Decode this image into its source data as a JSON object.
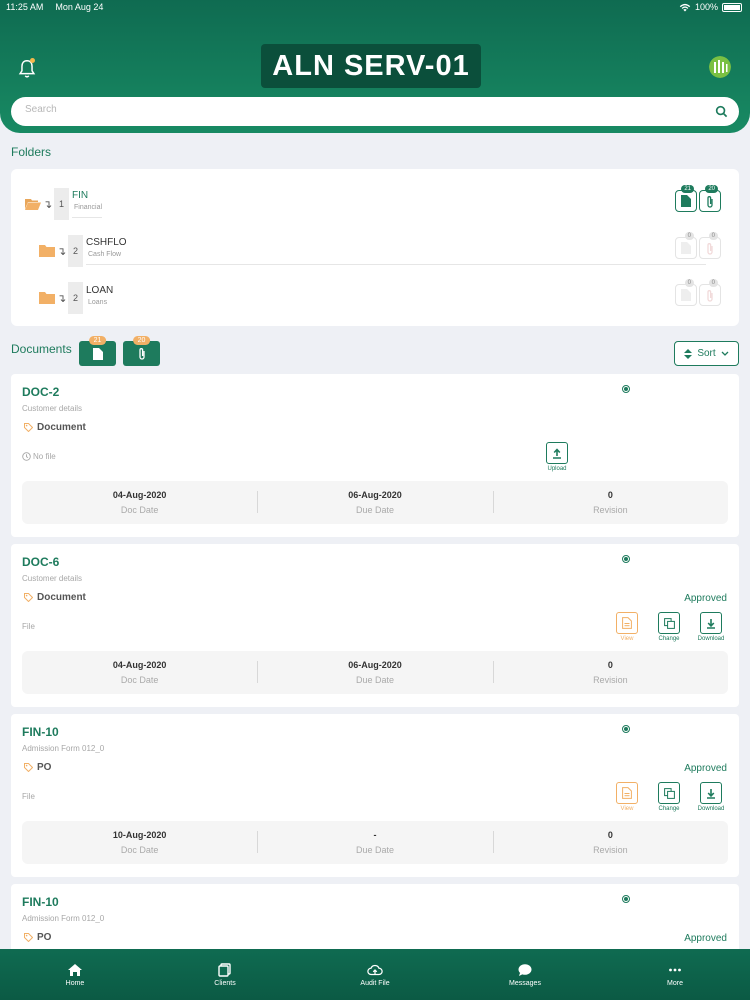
{
  "status_bar": {
    "time": "11:25 AM",
    "date": "Mon Aug 24",
    "battery": "100%"
  },
  "header": {
    "title": "ALN SERV-01"
  },
  "search": {
    "placeholder": "Search"
  },
  "folders": {
    "label": "Folders",
    "items": [
      {
        "level": "1",
        "name": "FIN",
        "sub": "Financial",
        "doc_count": "21",
        "attach_count": "20",
        "active": true
      },
      {
        "level": "2",
        "name": "CSHFLO",
        "sub": "Cash Flow",
        "doc_count": "0",
        "attach_count": "0",
        "active": false
      },
      {
        "level": "2",
        "name": "LOAN",
        "sub": "Loans",
        "doc_count": "0",
        "attach_count": "0",
        "active": false
      }
    ]
  },
  "documents": {
    "label": "Documents",
    "doc_count": "21",
    "attach_count": "20",
    "sort_label": "Sort"
  },
  "labels": {
    "doc_date": "Doc Date",
    "due_date": "Due Date",
    "revision": "Revision",
    "view": "View",
    "change": "Change",
    "download": "Download",
    "upload": "Upload"
  },
  "cards": [
    {
      "code": "DOC-2",
      "desc": "Customer details",
      "tag": "Document",
      "status": "",
      "file": "No file",
      "doc_date": "04-Aug-2020",
      "due_date": "06-Aug-2020",
      "revision": "0"
    },
    {
      "code": "DOC-6",
      "desc": "Customer details",
      "tag": "Document",
      "status": "Approved",
      "file": "File",
      "doc_date": "04-Aug-2020",
      "due_date": "06-Aug-2020",
      "revision": "0"
    },
    {
      "code": "FIN-10",
      "desc": "Admission Form 012_0",
      "tag": "PO",
      "status": "Approved",
      "file": "File",
      "doc_date": "10-Aug-2020",
      "due_date": "-",
      "revision": "0"
    },
    {
      "code": "FIN-10",
      "desc": "Admission Form 012_0",
      "tag": "PO",
      "status": "Approved"
    }
  ],
  "nav": [
    {
      "label": "Home",
      "icon": "home-icon"
    },
    {
      "label": "Clients",
      "icon": "clients-icon"
    },
    {
      "label": "Audit File",
      "icon": "cloud-upload-icon"
    },
    {
      "label": "Messages",
      "icon": "chat-icon"
    },
    {
      "label": "More",
      "icon": "more-icon"
    }
  ],
  "colors": {
    "brand": "#1e7b5d",
    "brand_dark": "#0b4f3b",
    "accent": "#f2b066"
  }
}
